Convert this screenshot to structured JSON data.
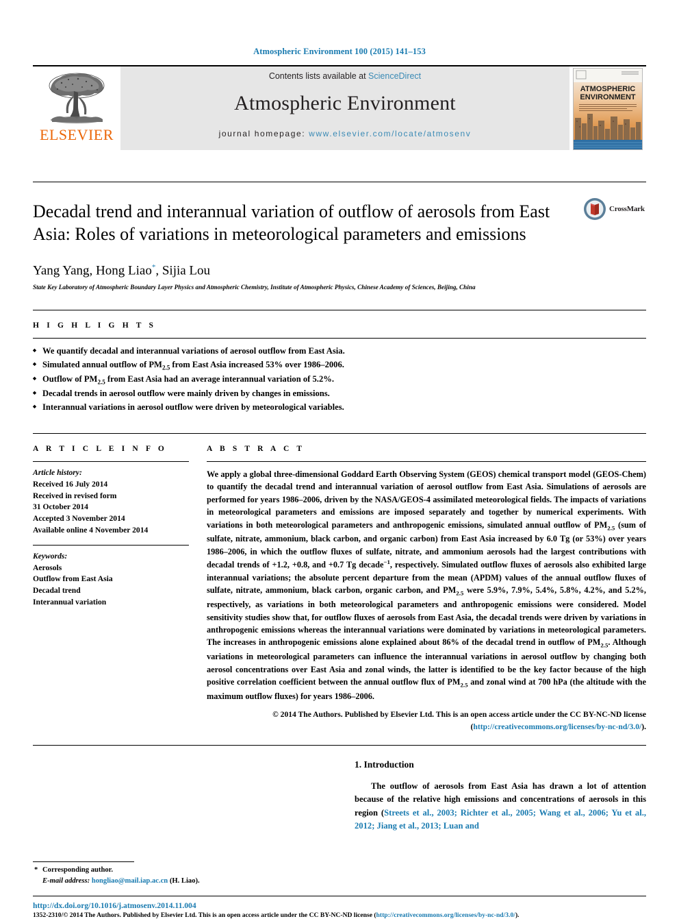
{
  "running_head": "Atmospheric Environment 100 (2015) 141–153",
  "masthead": {
    "publisher_name": "ELSEVIER",
    "contents_prefix": "Contents lists available at ",
    "contents_link": "ScienceDirect",
    "journal_name": "Atmospheric Environment",
    "homepage_label": "journal homepage: ",
    "homepage_url": "www.elsevier.com/locate/atmosenv",
    "cover_title_line1": "ATMOSPHERIC",
    "cover_title_line2": "ENVIRONMENT"
  },
  "article": {
    "title": "Decadal trend and interannual variation of outflow of aerosols from East Asia: Roles of variations in meteorological parameters and emissions",
    "crossmark_label": "CrossMark",
    "authors_part1": "Yang Yang, Hong Liao",
    "authors_marker": "*",
    "authors_part2": ", Sijia Lou",
    "affiliation": "State Key Laboratory of Atmospheric Boundary Layer Physics and Atmospheric Chemistry, Institute of Atmospheric Physics, Chinese Academy of Sciences, Beijing, China"
  },
  "highlights": {
    "heading": "H I G H L I G H T S",
    "items": [
      "We quantify decadal and interannual variations of aerosol outflow from East Asia.",
      "Simulated annual outflow of PM2.5 from East Asia increased 53% over 1986–2006.",
      "Outflow of PM2.5 from East Asia had an average interannual variation of 5.2%.",
      "Decadal trends in aerosol outflow were mainly driven by changes in emissions.",
      "Interannual variations in aerosol outflow were driven by meteorological variables."
    ]
  },
  "article_info": {
    "heading": "A R T I C L E   I N F O",
    "history_label": "Article history:",
    "history": [
      "Received 16 July 2014",
      "Received in revised form",
      "31 October 2014",
      "Accepted 3 November 2014",
      "Available online 4 November 2014"
    ],
    "keywords_label": "Keywords:",
    "keywords": [
      "Aerosols",
      "Outflow from East Asia",
      "Decadal trend",
      "Interannual variation"
    ]
  },
  "abstract": {
    "heading": "A B S T R A C T",
    "text": "We apply a global three-dimensional Goddard Earth Observing System (GEOS) chemical transport model (GEOS-Chem) to quantify the decadal trend and interannual variation of aerosol outflow from East Asia. Simulations of aerosols are performed for years 1986–2006, driven by the NASA/GEOS-4 assimilated meteorological fields. The impacts of variations in meteorological parameters and emissions are imposed separately and together by numerical experiments. With variations in both meteorological parameters and anthropogenic emissions, simulated annual outflow of PM2.5 (sum of sulfate, nitrate, ammonium, black carbon, and organic carbon) from East Asia increased by 6.0 Tg (or 53%) over years 1986–2006, in which the outflow fluxes of sulfate, nitrate, and ammonium aerosols had the largest contributions with decadal trends of +1.2, +0.8, and +0.7 Tg decade−1, respectively. Simulated outflow fluxes of aerosols also exhibited large interannual variations; the absolute percent departure from the mean (APDM) values of the annual outflow fluxes of sulfate, nitrate, ammonium, black carbon, organic carbon, and PM2.5 were 5.9%, 7.9%, 5.4%, 5.8%, 4.2%, and 5.2%, respectively, as variations in both meteorological parameters and anthropogenic emissions were considered. Model sensitivity studies show that, for outflow fluxes of aerosols from East Asia, the decadal trends were driven by variations in anthropogenic emissions whereas the interannual variations were dominated by variations in meteorological parameters. The increases in anthropogenic emissions alone explained about 86% of the decadal trend in outflow of PM2.5. Although variations in meteorological parameters can influence the interannual variations in aerosol outflow by changing both aerosol concentrations over East Asia and zonal winds, the latter is identified to be the key factor because of the high positive correlation coefficient between the annual outflow flux of PM2.5 and zonal wind at 700 hPa (the altitude with the maximum outflow fluxes) for years 1986–2006.",
    "copyright": "© 2014 The Authors. Published by Elsevier Ltd. This is an open access article under the CC BY-NC-ND license (",
    "copyright_link": "http://creativecommons.org/licenses/by-nc-nd/3.0/",
    "copyright_end": ")."
  },
  "introduction": {
    "heading": "1. Introduction",
    "paragraph_part1": "The outflow of aerosols from East Asia has drawn a lot of attention because of the relative high emissions and concentrations of aerosols in this region (",
    "citations": "Streets et al., 2003; Richter et al., 2005; Wang et al., 2006; Yu et al., 2012; Jiang et al., 2013; Luan and"
  },
  "corresponding": {
    "marker": "*",
    "label": "Corresponding author.",
    "email_label": "E-mail address:",
    "email": "hongliao@mail.iap.ac.cn",
    "email_suffix": "(H. Liao)."
  },
  "footer": {
    "doi": "http://dx.doi.org/10.1016/j.atmosenv.2014.11.004",
    "issn_text": "1352-2310/© 2014 The Authors. Published by Elsevier Ltd. This is an open access article under the CC BY-NC-ND license (",
    "issn_link": "http://creativecommons.org/licenses/by-nc-nd/3.0/",
    "issn_end": ")."
  },
  "colors": {
    "link_blue": "#1a7bb0",
    "elsevier_orange": "#eb6608",
    "band_gray": "#e6e6e6"
  }
}
